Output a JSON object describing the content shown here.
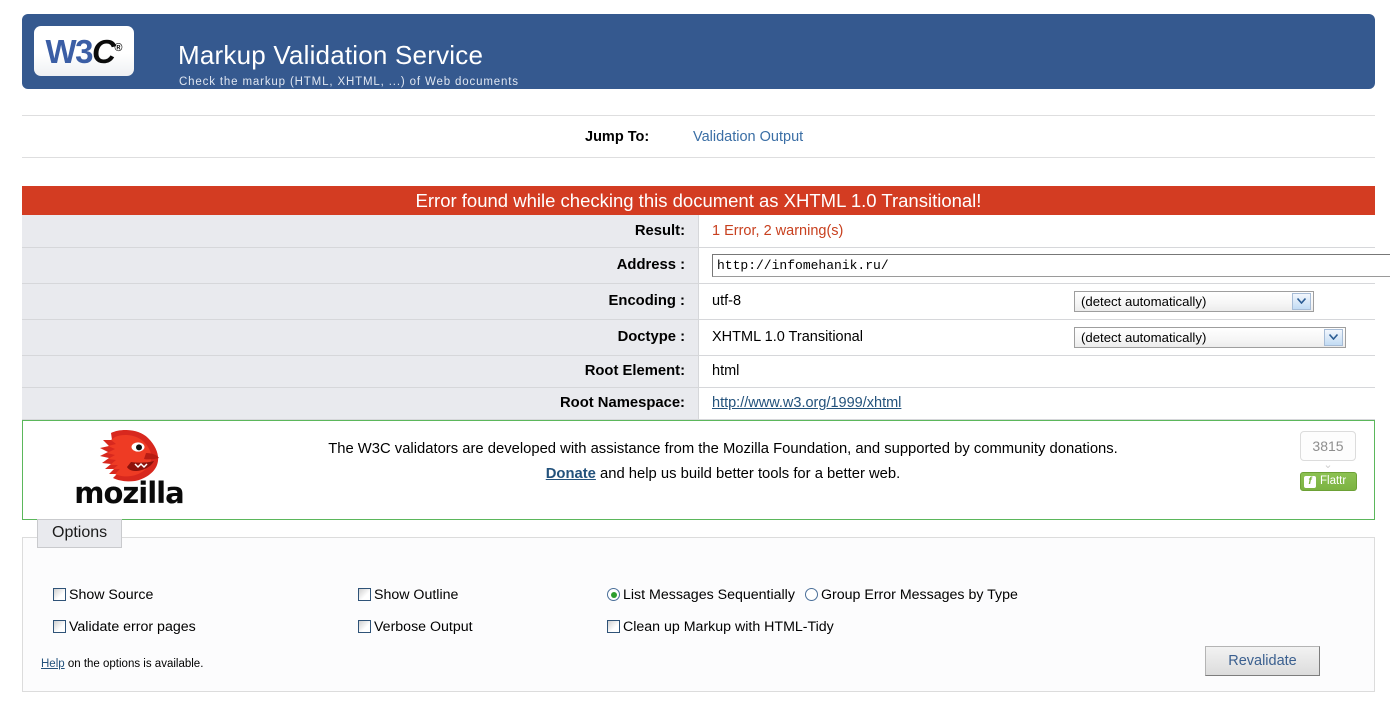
{
  "header": {
    "logo_w3": "W3",
    "logo_c": "C",
    "logo_reg": "®",
    "title": "Markup Validation Service",
    "subtitle": "Check the markup (HTML, XHTML, ...) of Web documents",
    "bg_color": "#35598f"
  },
  "jump": {
    "label": "Jump To:",
    "link": "Validation Output"
  },
  "result": {
    "banner": "Error found while checking this document as XHTML 1.0 Transitional!",
    "banner_color": "#d33c22",
    "rows": {
      "result_label": "Result:",
      "result_value": "1 Error, 2 warning(s)",
      "address_label": "Address :",
      "address_value": "http://infomehanik.ru/",
      "address_placeholder": "Address",
      "encoding_label": "Encoding :",
      "encoding_value": "utf-8",
      "encoding_select": "(detect automatically)",
      "doctype_label": "Doctype :",
      "doctype_value": "XHTML 1.0 Transitional",
      "doctype_select": "(detect automatically)",
      "root_element_label": "Root Element:",
      "root_element_value": "html",
      "root_namespace_label": "Root Namespace:",
      "root_namespace_value": "http://www.w3.org/1999/xhtml"
    }
  },
  "donation": {
    "logo_word": "mozilla",
    "line1": "The W3C validators are developed with assistance from the Mozilla Foundation, and supported by community donations.",
    "donate_link": "Donate",
    "line2_rest": " and help us build better tools for a better web.",
    "border_color": "#5bb75b",
    "flattr": {
      "count": "3815",
      "caret": "⌄",
      "icon": "flattr-icon",
      "label": "Flattr",
      "color": "#7cb342"
    }
  },
  "options": {
    "legend": "Options",
    "checkboxes": [
      {
        "label": "Show Source",
        "checked": false
      },
      {
        "label": "Show Outline",
        "checked": false
      },
      {
        "label": "Validate error pages",
        "checked": false
      },
      {
        "label": "Verbose Output",
        "checked": false
      },
      {
        "label": "Clean up Markup with HTML-Tidy",
        "checked": false
      }
    ],
    "radios": [
      {
        "label": "List Messages Sequentially",
        "checked": true
      },
      {
        "label": "Group Error Messages by Type",
        "checked": false
      }
    ],
    "help_link": "Help",
    "help_rest": " on the options is available.",
    "revalidate": "Revalidate"
  }
}
